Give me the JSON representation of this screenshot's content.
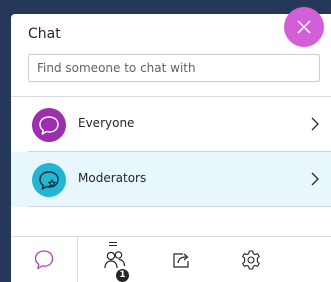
{
  "panel": {
    "title": "Chat",
    "search": {
      "placeholder": "Find someone to chat with"
    }
  },
  "chats": [
    {
      "label": "Everyone",
      "icon": "chat-bubble-icon",
      "color": "#9b2fae"
    },
    {
      "label": "Moderators",
      "icon": "moderator-chat-icon",
      "color": "#22b6d4"
    }
  ],
  "bottom_bar": {
    "tabs": [
      {
        "name": "chat",
        "icon": "chat-icon",
        "active": true
      },
      {
        "name": "attendees",
        "icon": "attendees-icon",
        "badge": "1"
      },
      {
        "name": "share-content",
        "icon": "share-icon"
      },
      {
        "name": "settings",
        "icon": "gear-icon"
      },
      {
        "name": "close",
        "icon": "close-icon"
      }
    ]
  },
  "colors": {
    "background": "#26385a",
    "accent": "#d35fd8",
    "selected_row": "#e8f7fb"
  }
}
